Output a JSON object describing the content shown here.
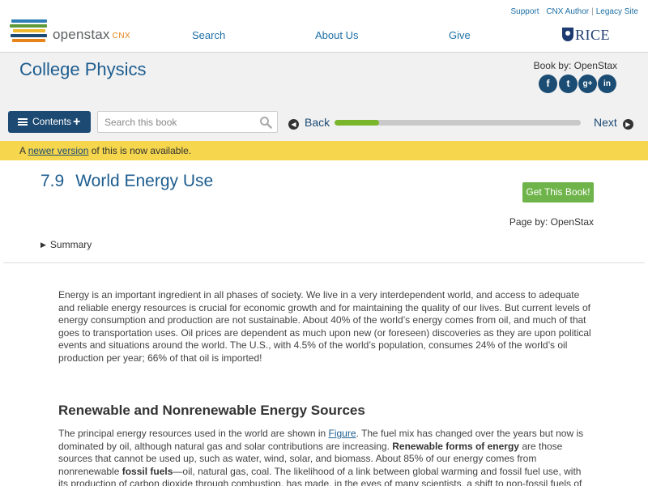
{
  "header": {
    "logo_text": "openstax",
    "logo_suffix": "CNX",
    "logo_colors": [
      "#1d4a73",
      "#f0b82c",
      "#5e9a3a",
      "#e8831a",
      "#2e7fb8"
    ],
    "util_links": [
      "Support",
      "CNX Author",
      "Legacy Site"
    ],
    "nav": [
      "Search",
      "About Us",
      "Give"
    ],
    "partner": "RICE",
    "link_color": "#1d6fa5"
  },
  "book": {
    "title": "College Physics",
    "by": "Book by: OpenStax",
    "social": [
      {
        "icon": "facebook-icon",
        "glyph": "f"
      },
      {
        "icon": "twitter-icon",
        "glyph": "t"
      },
      {
        "icon": "google-plus-icon",
        "glyph": "g+"
      },
      {
        "icon": "linkedin-icon",
        "glyph": "in"
      }
    ]
  },
  "toolbar": {
    "contents_label": "Contents",
    "search_placeholder": "Search this book",
    "back_label": "Back",
    "next_label": "Next",
    "progress_fraction": 0.18,
    "progress_color": "#7ab62c"
  },
  "notice": {
    "prefix": "A ",
    "link": "newer version",
    "suffix": " of this is now available.",
    "color": "#f5d64c"
  },
  "page": {
    "chapter_number": "7.9",
    "chapter_title": "World Energy Use",
    "get_book": "Get This Book!",
    "page_by": "Page by: OpenStax",
    "summary": "Summary",
    "intro": "Energy is an important ingredient in all phases of society. We live in a very interdependent world, and access to adequate and reliable energy resources is crucial for economic growth and for maintaining the quality of our lives. But current levels of energy consumption and production are not sustainable. About 40% of the world’s energy comes from oil, and much of that goes to transportation uses. Oil prices are dependent as much upon new (or foreseen) discoveries as they are upon political events and situations around the world. The U.S., with 4.5% of the world’s population, consumes 24% of the world’s oil production per year; 66% of that oil is imported!",
    "section_heading": "Renewable and Nonrenewable Energy Sources",
    "p2_a": "The principal energy resources used in the world are shown in ",
    "p2_link": "Figure",
    "p2_b": ". The fuel mix has changed over the years but now is dominated by oil, although natural gas and solar contributions are increasing. ",
    "p2_bold1": "Renewable forms of energy",
    "p2_c": " are those sources that cannot be used up, such as water, wind, solar, and biomass. About 85% of our energy comes from nonrenewable ",
    "p2_bold2": "fossil fuels",
    "p2_d": "—oil, natural gas, coal. The likelihood of a link between global warming and fossil fuel use, with its production of carbon dioxide through combustion, has made, in the eyes of many scientists, a shift to non-fossil fuels of utmost importance—but it will not be easy."
  }
}
